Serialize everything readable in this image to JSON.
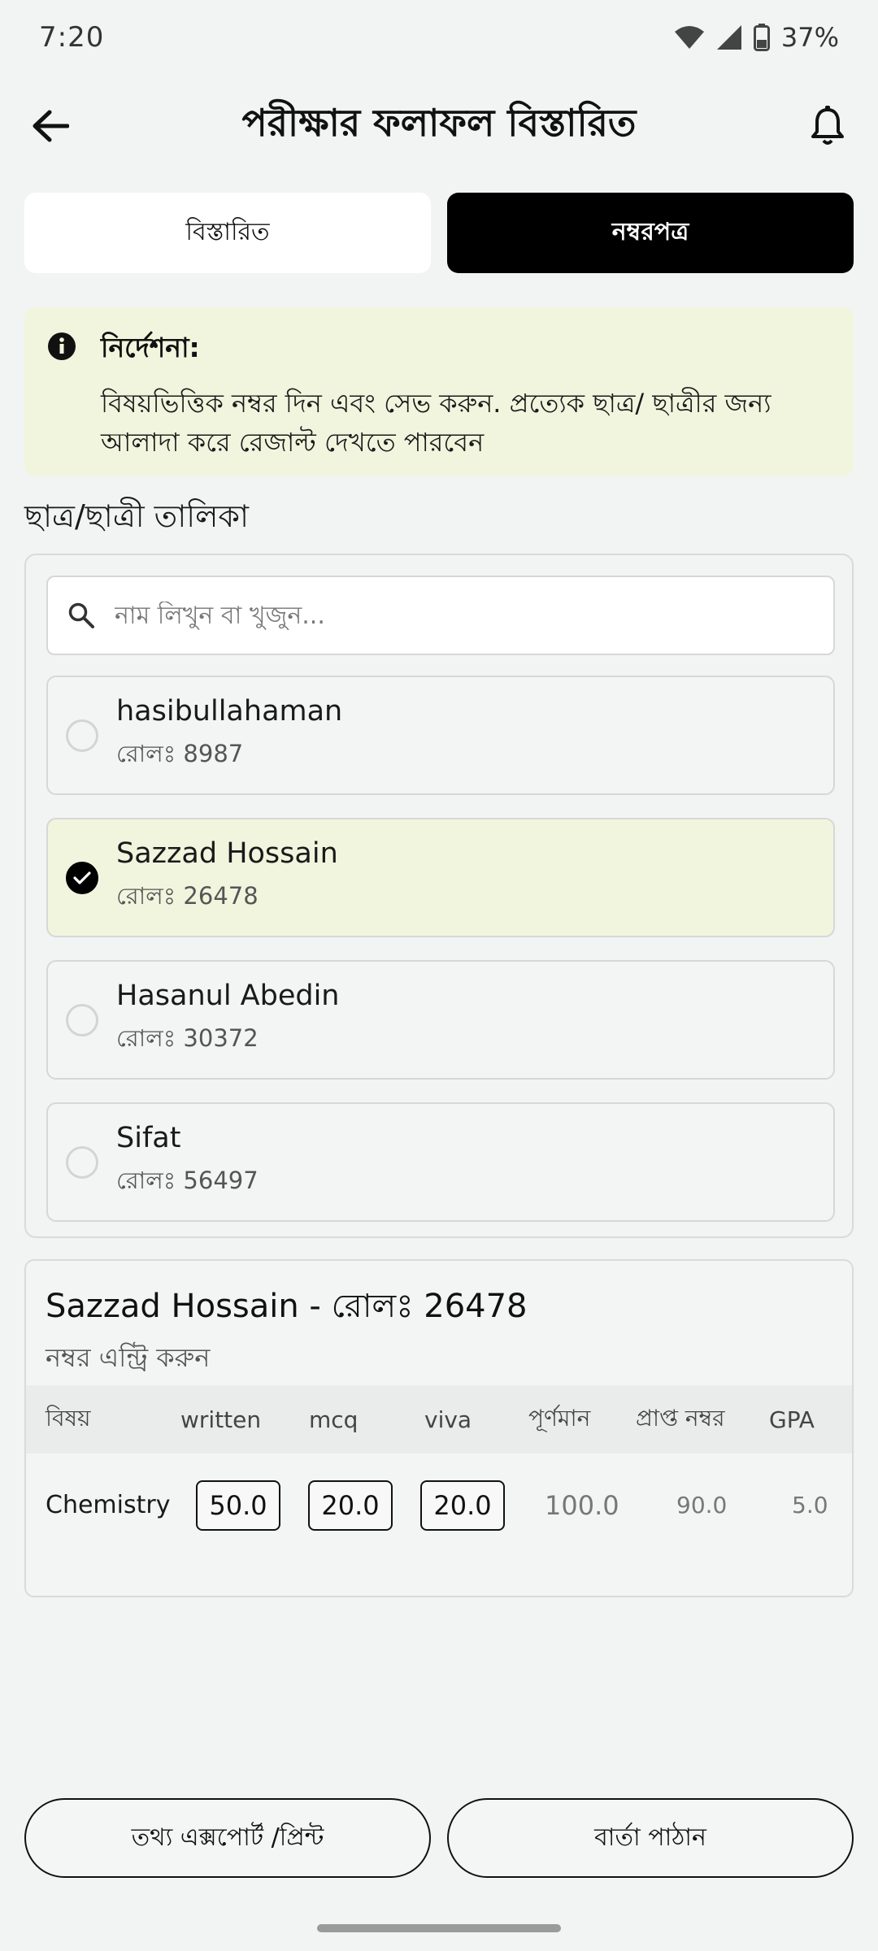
{
  "status": {
    "time": "7:20",
    "battery": "37%"
  },
  "header": {
    "title": "পরীক্ষার ফলাফল বিস্তারিত"
  },
  "tabs": [
    {
      "label": "বিস্তারিত",
      "active": false
    },
    {
      "label": "নম্বরপত্র",
      "active": true
    }
  ],
  "instruction": {
    "title": "নির্দেশনা:",
    "body": "বিষয়ভিত্তিক নম্বর দিন এবং সেভ করুন. প্রত্যেক ছাত্র/ ছাত্রীর জন্য আলাদা করে রেজাল্ট দেখতে পারবেন"
  },
  "student_list": {
    "title": "ছাত্র/ছাত্রী তালিকা",
    "search_placeholder": "নাম লিখুন বা খুজুন...",
    "students": [
      {
        "name": "hasibullahaman",
        "roll": "রোলঃ 8987",
        "selected": false
      },
      {
        "name": "Sazzad Hossain",
        "roll": "রোলঃ 26478",
        "selected": true
      },
      {
        "name": "Hasanul Abedin",
        "roll": "রোলঃ 30372",
        "selected": false
      },
      {
        "name": "Sifat",
        "roll": "রোলঃ 56497",
        "selected": false
      }
    ]
  },
  "result": {
    "title": "Sazzad Hossain - রোলঃ 26478",
    "subtitle": "নম্বর এন্ট্রি করুন",
    "columns": [
      "বিষয়",
      "written",
      "mcq",
      "viva",
      "পূর্ণমান",
      "প্রাপ্ত নম্বর",
      "GPA"
    ],
    "rows": [
      {
        "subject": "Chemistry",
        "written": "50.0",
        "mcq": "20.0",
        "viva": "20.0",
        "full_marks": "100.0",
        "obtained": "90.0",
        "gpa": "5.0"
      }
    ]
  },
  "actions": {
    "export_label": "তথ্য এক্সপোর্ট /প্রিন্ট",
    "message_label": "বার্তা পাঠান"
  },
  "colors": {
    "accent_bg": "#F1F5DE",
    "active_tab": "#000000",
    "page_bg": "#F2F4F3"
  }
}
